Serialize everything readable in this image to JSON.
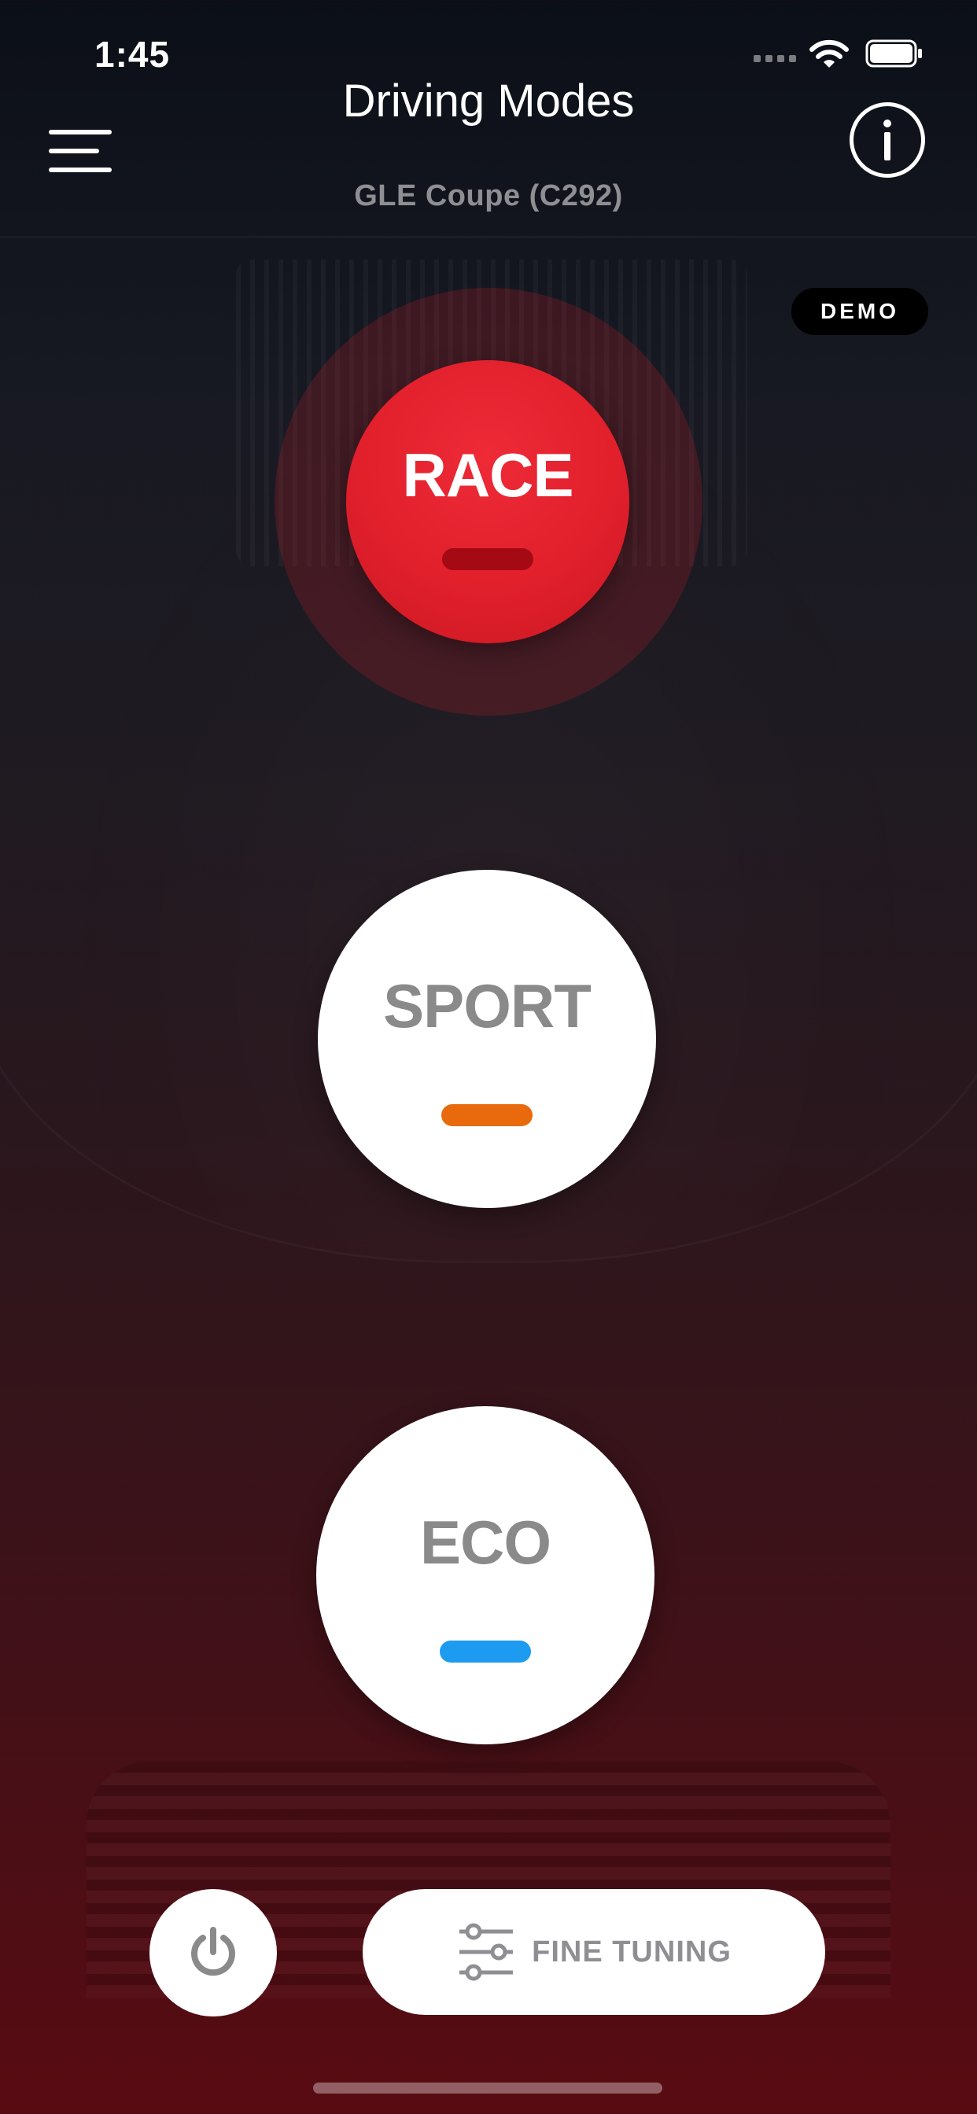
{
  "status_bar": {
    "time": "1:45"
  },
  "header": {
    "title": "Driving Modes",
    "subtitle": "GLE Coupe (C292)",
    "menu_icon": "hamburger-menu-icon",
    "info_icon": "info-circle-icon"
  },
  "badge": {
    "label": "DEMO"
  },
  "modes": [
    {
      "label": "RACE",
      "active": true,
      "button_color": "#e1202c",
      "indicator_color": "#a50a14"
    },
    {
      "label": "SPORT",
      "active": false,
      "button_color": "#ffffff",
      "indicator_color": "#e86a0c"
    },
    {
      "label": "ECO",
      "active": false,
      "button_color": "#ffffff",
      "indicator_color": "#1d9bf0"
    }
  ],
  "footer": {
    "power_icon": "power-icon",
    "tuning_icon": "sliders-icon",
    "tuning_label": "FINE TUNING"
  },
  "colors": {
    "accent_red": "#e1202c",
    "text_gray": "#8e8e93",
    "background_top": "#0b0f17",
    "background_bottom": "#590b12"
  }
}
